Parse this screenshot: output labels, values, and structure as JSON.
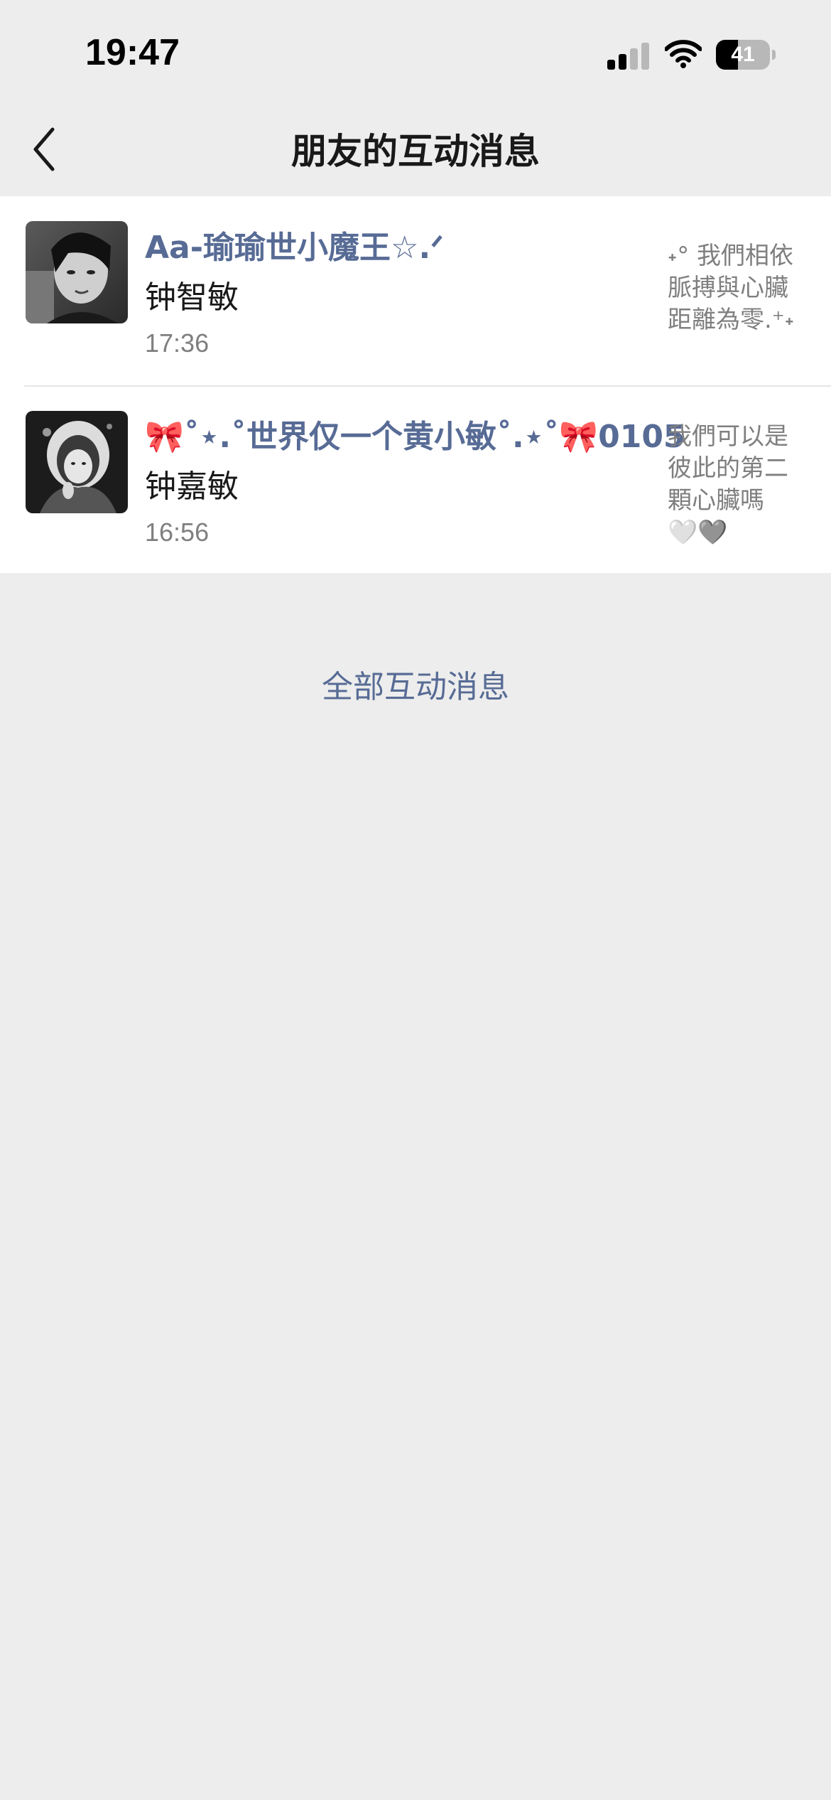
{
  "status_bar": {
    "time": "19:47",
    "battery": "41"
  },
  "nav": {
    "title": "朋友的互动消息"
  },
  "messages": [
    {
      "nickname": "Aa-瑜瑜世小魔王☆.ᐟ",
      "remark": "钟智敏",
      "time": "17:36",
      "preview_lines": [
        "˖° 我們相依",
        "脈搏與心臟",
        "距離為零.⁺˖"
      ]
    },
    {
      "nickname": "🎀˚⋆.˚世界仅一个黄小敏˚.⋆˚🎀0105",
      "remark": "钟嘉敏",
      "time": "16:56",
      "preview_lines": [
        "我們可以是",
        "彼此的第二",
        "顆心臟嗎",
        "🤍🩶"
      ]
    }
  ],
  "footer": {
    "all_messages_label": "全部互动消息"
  },
  "colors": {
    "background": "#ededed",
    "link": "#576b95",
    "text": "#191919",
    "secondary": "#7f7f7f"
  }
}
